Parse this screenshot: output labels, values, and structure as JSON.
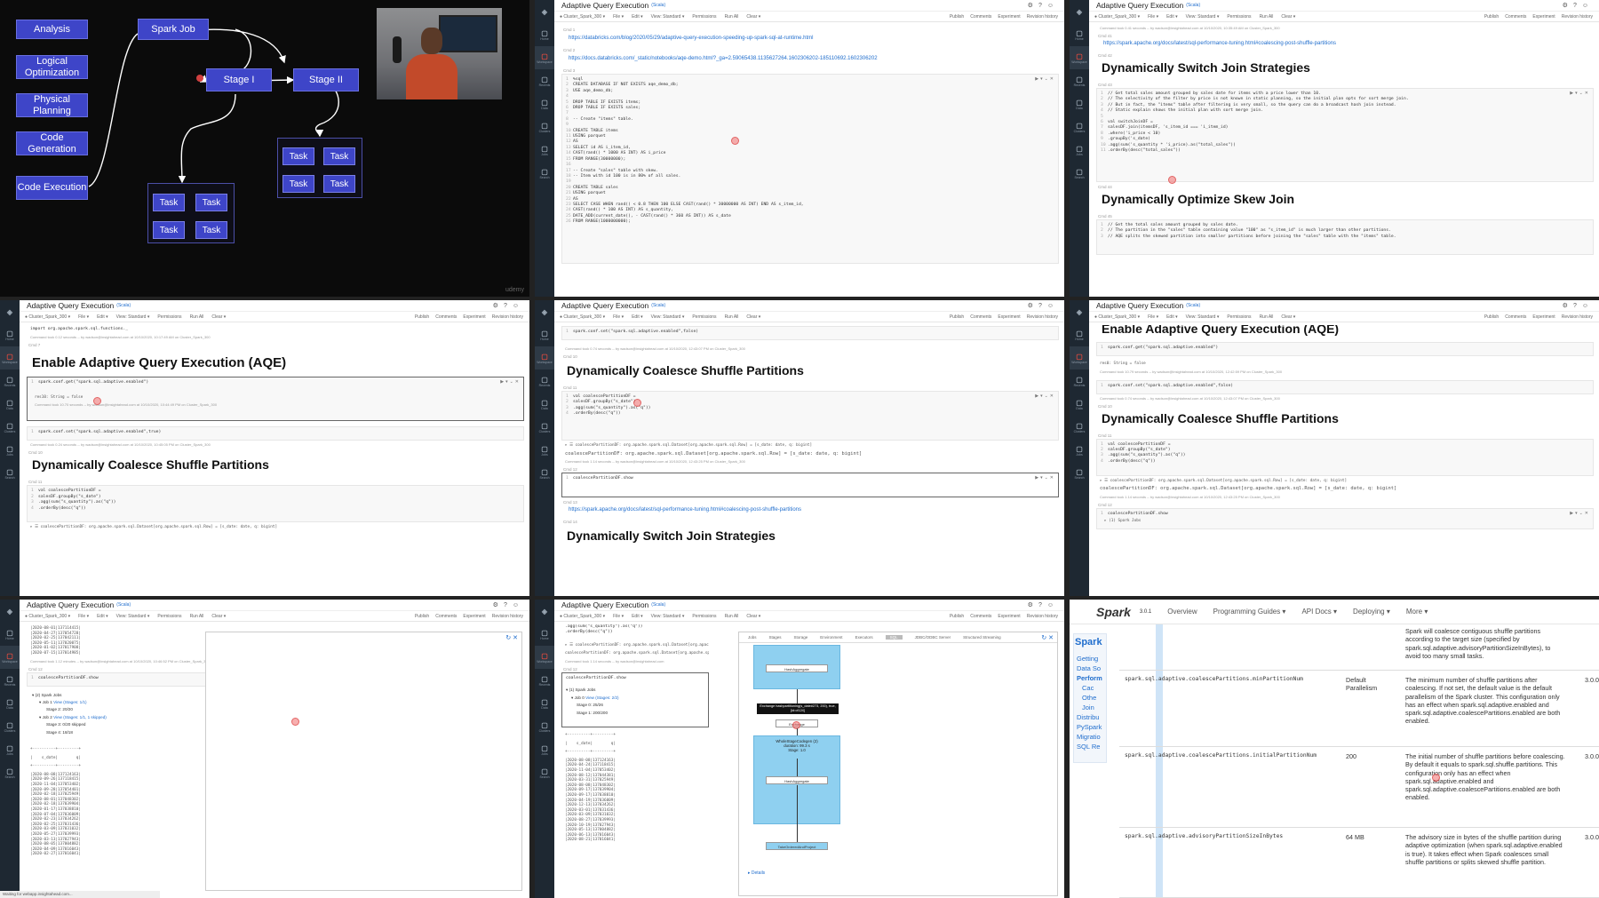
{
  "diagram": {
    "steps": [
      "Analysis",
      "Logical Optimization",
      "Physical Planning",
      "Code Generation",
      "Code Execution"
    ],
    "spark_job": "Spark Job",
    "stage1": "Stage I",
    "stage2": "Stage II",
    "task": "Task",
    "watermark": "udemy"
  },
  "nb": {
    "title": "Adaptive Query Execution",
    "scala": "(Scala)",
    "cluster": "Cluster_Spark_300",
    "menu": [
      "File",
      "Edit",
      "View: Standard",
      "Permissions",
      "Run All",
      "Clear"
    ],
    "right_menu": [
      "Publish",
      "Comments",
      "Experiment",
      "Revision history"
    ],
    "side": [
      {
        "name": "databricks-icon",
        "label": ""
      },
      {
        "name": "home-icon",
        "label": "Home"
      },
      {
        "name": "workspace-icon",
        "label": "Workspace"
      },
      {
        "name": "recents-icon",
        "label": "Recents"
      },
      {
        "name": "data-icon",
        "label": "Data"
      },
      {
        "name": "clusters-icon",
        "label": "Clusters"
      },
      {
        "name": "jobs-icon",
        "label": "Jobs"
      },
      {
        "name": "search-icon",
        "label": "Search"
      }
    ]
  },
  "p2": {
    "cmd1": "Cmd 1",
    "link1": "https://databricks.com/blog/2020/05/29/adaptive-query-execution-speeding-up-spark-sql-at-runtime.html",
    "cmd2": "Cmd 2",
    "link2": "https://docs.databricks.com/_static/notebooks/aqe-demo.html?_ga=2.59065438.1135627264.1602306202-185110692.1602306202",
    "cmd3": "Cmd 3",
    "code": [
      "%sql",
      "CREATE DATABASE IF NOT EXISTS aqe_demo_db;",
      "USE aqe_demo_db;",
      "",
      "DROP TABLE IF EXISTS items;",
      "DROP TABLE IF EXISTS sales;",
      "",
      "-- Create \"items\" table.",
      "",
      "CREATE TABLE items",
      "USING parquet",
      "AS",
      "SELECT id AS i_item_id,",
      "CAST(rand() * 1000 AS INT) AS i_price",
      "FROM RANGE(30000000);",
      "",
      "-- Create \"sales\" table with skew.",
      "-- Item with id 100 is in 80% of all sales.",
      "",
      "CREATE TABLE sales",
      "USING parquet",
      "AS",
      "SELECT CASE WHEN rand() < 0.8 THEN 100 ELSE CAST(rand() * 30000000 AS INT) END AS s_item_id,",
      "CAST(rand() * 100 AS INT) AS s_quantity,",
      "DATE_ADD(current_date(), - CAST(rand() * 360 AS INT)) AS s_date",
      "FROM RANGE(1000000000);"
    ]
  },
  "p3": {
    "info": "Command took 0.41 seconds -- by wadson@insightahead.com at 10/10/2020, 10:35:49 AM on Cluster_Spark_300",
    "cmd41": "Cmd 41",
    "link": "https://spark.apache.org/docs/latest/sql-performance-tuning.html#coalescing-post-shuffle-partitions",
    "cmd42": "Cmd 42",
    "h_switch": "Dynamically Switch Join Strategies",
    "cmd43": "Cmd 43",
    "code": [
      "// Get total sales amount grouped by sales date for items with a price lower than 10.",
      "// The selectivity of the filter by price is not known in static planning, so the initial plan opts for sort merge join.",
      "// But in fact, the \"items\" table after filtering is very small, so the query can do a broadcast hash join instead.",
      "// Static explain shows the initial plan with sort merge join.",
      "",
      "val switchJoinDF =",
      "salesDF.join(itemsDF, 's_item_id === 'i_item_id)",
      ".where('i_price < 10)",
      ".groupBy('s_date)",
      ".agg(sum('s_quantity * 'i_price).as(\"total_sales\"))",
      ".orderBy(desc(\"total_sales\"))"
    ],
    "cmd44": "Cmd 44",
    "h_skew": "Dynamically Optimize Skew Join",
    "cmd45": "Cmd 45",
    "code2": [
      "// Get the total sales amount grouped by sales date.",
      "// The partition in the \"sales\" table containing value \"100\" as \"s_item_id\" is much larger than other partitions.",
      "// AQE splits the skewed partition into smaller partitions before joining the \"sales\" table with the \"items\" table."
    ]
  },
  "p4": {
    "code0": "import org.apache.spark.sql.functions._",
    "info0": "Command took 0.12 seconds -- by wadson@insightahead.com at 10/10/2020, 10:17:49 AM on Cluster_Spark_300",
    "cmd7": "Cmd 7",
    "h_enable": "Enable Adaptive Query Execution (AQE)",
    "code1": "spark.conf.get(\"spark.sql.adaptive.enabled\")",
    "out1": "res10: String = false",
    "info1": "Command took 10.70 seconds -- by wadson@insightahead.com at 10/10/2020, 10:44:49 PM on Cluster_Spark_300",
    "code2": "spark.conf.set(\"spark.sql.adaptive.enabled\",true)",
    "info2": "Command took 0.24 seconds -- by wadson@insightahead.com at 10/10/2020, 10:45:05 PM on Cluster_Spark_300",
    "cmd10": "Cmd 10",
    "h_coalesce": "Dynamically Coalesce Shuffle Partitions",
    "cmd11": "Cmd 11",
    "code3": [
      "val coalescePartitionDF =",
      "salesDF.groupBy(\"s_date\")",
      ".agg(sum(\"s_quantity\").as(\"q\"))",
      ".orderBy(desc(\"q\"))"
    ],
    "out3": "▸ ☰ coalescePartitionDF: org.apache.spark.sql.Dataset[org.apache.spark.sql.Row] = [s_date: date, q: bigint]"
  },
  "p5": {
    "code1": "spark.conf.set(\"spark.sql.adaptive.enabled\",false)",
    "info1": "Command took 0.74 seconds -- by wadson@insightahead.com at 10/10/2020, 12:43:07 PM on Cluster_Spark_300",
    "cmd10": "Cmd 10",
    "h_coalesce": "Dynamically Coalesce Shuffle Partitions",
    "cmd11": "Cmd 11",
    "code2": [
      "val coalescePartitionDF =",
      "salesDF.groupBy(\"s_date\")",
      ".agg(sum(\"s_quantity\").as(\"q\"))",
      ".orderBy(desc(\"q\"))"
    ],
    "out2a": "▸ ☰ coalescePartitionDF: org.apache.spark.sql.Dataset[org.apache.spark.sql.Row] = [s_date: date, q: bigint]",
    "out2b": "coalescePartitionDF: org.apache.spark.sql.Dataset[org.apache.spark.sql.Row] = [s_date: date, q: bigint]",
    "info2": "Command took 1.14 seconds -- by wadson@insightahead.com at 10/10/2020, 12:43:25 PM on Cluster_Spark_300",
    "cmd12": "Cmd 12",
    "code3": "coalescePartitionDF.show",
    "cmd13": "Cmd 13",
    "link": "https://spark.apache.org/docs/latest/sql-performance-tuning.html#coalescing-post-shuffle-partitions",
    "cmd14": "Cmd 14",
    "h_switch": "Dynamically Switch Join Strategies"
  },
  "p6": {
    "h_top": "Enable Adaptive Query Execution (AQE)",
    "code1": "spark.conf.get(\"spark.sql.adaptive.enabled\")",
    "out1": "res0: String = false",
    "info1": "Command took 10.79 seconds -- by wadson@insightahead.com at 10/10/2020, 12:42:59 PM on Cluster_Spark_300",
    "code2": "spark.conf.set(\"spark.sql.adaptive.enabled\",false)",
    "info2": "Command took 0.74 seconds -- by wadson@insightahead.com at 10/10/2020, 12:43:07 PM on Cluster_Spark_300",
    "cmd10": "Cmd 10",
    "h_coalesce": "Dynamically Coalesce Shuffle Partitions",
    "cmd11": "Cmd 11",
    "code3": [
      "val coalescePartitionDF =",
      "salesDF.groupBy(\"s_date\")",
      ".agg(sum(\"s_quantity\").as(\"q\"))",
      ".orderBy(desc(\"q\"))"
    ],
    "out3a": "▸ ☰ coalescePartitionDF: org.apache.spark.sql.Dataset[org.apache.spark.sql.Row] = [s_date: date, q: bigint]",
    "out3b": "coalescePartitionDF: org.apache.spark.sql.Dataset[org.apache.spark.sql.Row] = [s_date: date, q: bigint]",
    "info3": "Command took 1.14 seconds -- by wadson@insightahead.com at 10/10/2020, 12:43:25 PM on Cluster_Spark_300",
    "cmd12": "Cmd 12",
    "code4": "coalescePartitionDF.show",
    "out4": "▸ (1) Spark Jobs"
  },
  "p7": {
    "rows": [
      "|2020-08-01|137114415|",
      "|2020-04-27|137054728|",
      "|2020-02-25|137042111|",
      "|2020-05-11|137020075|",
      "|2020-01-02|137017908|",
      "|2020-07-15|137014985|"
    ],
    "info0": "Command took 1.12 minutes -- by wadson@insightahead.com at 10/10/2020, 10:46:52 PM on Cluster_Spark_300",
    "cmd12": "Cmd 12",
    "code1": "coalescePartitionDF.show",
    "jobs": "▾ (2) Spark Jobs",
    "job1": "▾ Job 1",
    "job1v": "View (Stages: 1/1)",
    "stage2": "Stage 2: 20/20",
    "job2": "▾ Job 2",
    "job2v": "View (Stages: 1/1, 1 skipped)",
    "stage3": "Stage 3: 0/20 skipped",
    "stage4": "Stage 4: 18/18",
    "sep": "+----------+---------+",
    "header": "|    s_date|        q|",
    "rows2": [
      "|2020-08-08|137124163|",
      "|2020-09-26|137118415|",
      "|2020-11-04|137053402|",
      "|2020-09-28|137054401|",
      "|2020-02-18|137025949|",
      "|2020-08-01|137048302|",
      "|2020-02-18|137039904|",
      "|2020-01-17|137038810|",
      "|2020-07-04|137036009|",
      "|2020-02-23|137034262|",
      "|2020-02-25|137031436|",
      "|2020-03-09|137031032|",
      "|2020-05-27|137039993|",
      "|2020-03-13|137027943|",
      "|2020-08-05|137004882|",
      "|2020-04-09|137016043|",
      "|2020-02-27|137016041|"
    ],
    "status": "Waiting for webapp.insightahead.com..."
  },
  "p8": {
    "code0": ".agg(sum(\"s_quantity\").as(\"q\"))\n.orderBy(desc(\"q\"))",
    "out0a": "▸ ☰ coalescePartitionDF: org.apache.spark.sql.Dataset[org.apache.spark.sql.Row] = [s_date: date, q: bigint]",
    "out0b": "coalescePartitionDF: org.apache.spark.sql.Dataset[org.apache.spark.sql.Row]",
    "info0": "Command took 1.14 seconds -- by wadson@insightahead.com",
    "cmd12": "Cmd 12",
    "code1": "coalescePartitionDF.show",
    "jobs": "▾ (1) Spark Jobs",
    "job0": "▾ Job 0",
    "job0v": "View (Stages: 2/2)",
    "stage0": "Stage 0: 25/26",
    "stage1": "Stage 1: 200/200",
    "sep": "+----------+---------+",
    "header": "|    s_date|        q|",
    "rows": [
      "|2020-08-08|137124163|",
      "|2020-04-24|137118415|",
      "|2020-11-04|137053402|",
      "|2020-08-12|137044381|",
      "|2020-03-31|137025949|",
      "|2020-08-08|137048302|",
      "|2020-09-17|137039904|",
      "|2020-09-17|137038810|",
      "|2020-04-19|137036009|",
      "|2020-12-13|137034262|",
      "|2020-03-01|137031436|",
      "|2020-03-09|137031032|",
      "|2020-08-27|137039993|",
      "|2020-10-19|137027943|",
      "|2020-05-13|137004882|",
      "|2020-06-13|137016043|",
      "|2020-08-21|137016041|"
    ],
    "ui_tabs": [
      "Jobs",
      "Stages",
      "Storage",
      "Environment",
      "Executors",
      "SQL",
      "JDBC/ODBC Server",
      "Structured Streaming"
    ],
    "node1": "HashAggregate",
    "exchange": "Exchange hashpartitioning(s_date#273, 200), true, [id=#124]",
    "exch_label": "Exchange",
    "node2": "WholeStageCodegen (2)",
    "node2_sub": "duration: 99.3 s",
    "node2_sub2": "Stage: 1.0",
    "node3": "HashAggregate",
    "node4": "TakeOrderedAndProject",
    "details": "▸ Details"
  },
  "p9": {
    "logo": "Spark",
    "version": "3.0.1",
    "nav": [
      "Overview",
      "Programming Guides ▾",
      "API Docs ▾",
      "Deploying ▾",
      "More ▾"
    ],
    "side_title": "Spark",
    "side_links": [
      "Getting",
      "Data So",
      "Perform",
      "Cac",
      "Othe",
      "Join",
      "Distribu",
      "PySpark",
      "Migratio",
      "SQL Re"
    ],
    "rows": [
      {
        "key": "",
        "default": "",
        "meaning": "Spark will coalesce contiguous shuffle partitions according to the target size (specified by spark.sql.adaptive.advisoryPartitionSizeInBytes), to avoid too many small tasks.",
        "version": ""
      },
      {
        "key": "spark.sql.adaptive.coalescePartitions.minPartitionNum",
        "default": "Default Parallelism",
        "meaning": "The minimum number of shuffle partitions after coalescing. If not set, the default value is the default parallelism of the Spark cluster. This configuration only has an effect when spark.sql.adaptive.enabled and spark.sql.adaptive.coalescePartitions.enabled are both enabled.",
        "version": "3.0.0"
      },
      {
        "key": "spark.sql.adaptive.coalescePartitions.initialPartitionNum",
        "default": "200",
        "meaning": "The initial number of shuffle partitions before coalescing. By default it equals to spark.sql.shuffle.partitions. This configuration only has an effect when spark.sql.adaptive.enabled and spark.sql.adaptive.coalescePartitions.enabled are both enabled.",
        "version": "3.0.0"
      },
      {
        "key": "spark.sql.adaptive.advisoryPartitionSizeInBytes",
        "default": "64 MB",
        "meaning": "The advisory size in bytes of the shuffle partition during adaptive optimization (when spark.sql.adaptive.enabled is true). It takes effect when Spark coalesces small shuffle partitions or splits skewed shuffle partition.",
        "version": "3.0.0"
      }
    ]
  }
}
